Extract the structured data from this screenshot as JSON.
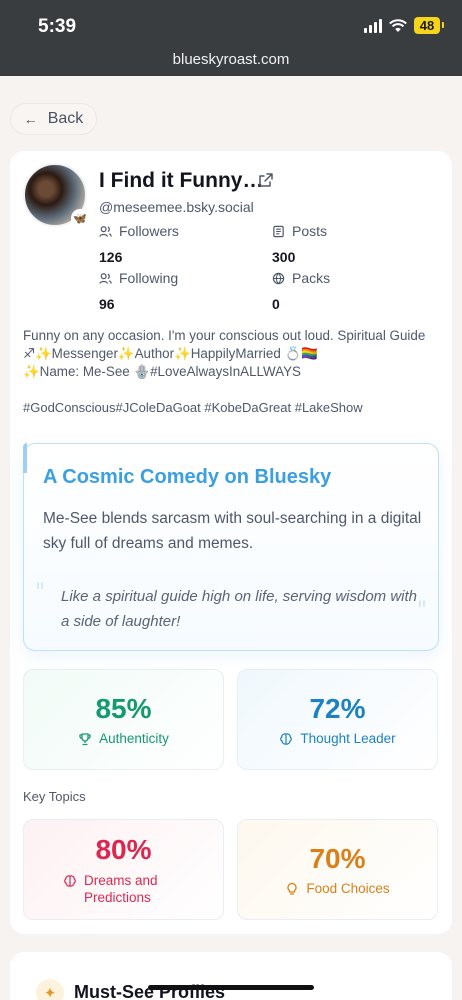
{
  "status_bar": {
    "time": "5:39",
    "battery": "48"
  },
  "browser": {
    "url": "blueskyroast.com"
  },
  "nav": {
    "back_label": "Back"
  },
  "profile": {
    "display_name": "I Find it Funny…",
    "handle": "@meseemee.bsky.social",
    "stats": {
      "followers_label": "Followers",
      "followers": "126",
      "posts_label": "Posts",
      "posts": "300",
      "following_label": "Following",
      "following": "96",
      "packs_label": "Packs",
      "packs": "0"
    },
    "bio_line1": "Funny on any occasion. I'm your conscious out loud. Spiritual Guide",
    "bio_line2": "♐✨Messenger✨Author✨HappilyMarried 💍🏳️‍🌈",
    "bio_line3": "✨Name: Me-See 🪬#LoveAlwaysInALLWAYS",
    "hashtags": "#GodConscious#JColeDaGoat #KobeDaGreat #LakeShow"
  },
  "roast": {
    "title": "A Cosmic Comedy on Bluesky",
    "description": "Me-See blends sarcasm with soul-searching in a digital sky full of dreams and memes.",
    "quote": "Like a spiritual guide high on life, serving wisdom with a side of laughter!"
  },
  "scores": [
    {
      "value": "85%",
      "label": "Authenticity",
      "icon": "trophy-icon",
      "color": "#149a6e"
    },
    {
      "value": "72%",
      "label": "Thought Leader",
      "icon": "brain-icon",
      "color": "#1c82c4"
    }
  ],
  "key_topics_label": "Key Topics",
  "topics": [
    {
      "value": "80%",
      "label": "Dreams and Predictions",
      "icon": "brain-icon",
      "color": "#dc2850"
    },
    {
      "value": "70%",
      "label": "Food Choices",
      "icon": "lightbulb-icon",
      "color": "#d9801b"
    }
  ],
  "next_section": {
    "title": "Must-See Profiles",
    "icon": "sparkles-icon"
  }
}
